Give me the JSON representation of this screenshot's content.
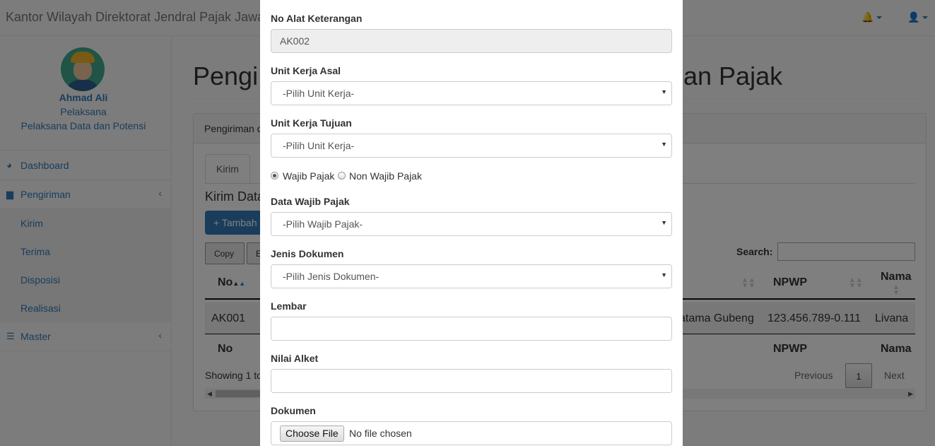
{
  "navbar": {
    "brand": "Kantor Wilayah Direktorat Jendral Pajak Jawa",
    "bell_icon": "bell-icon",
    "user_icon": "user-icon"
  },
  "sidebar": {
    "profile": {
      "name": "Ahmad Ali",
      "role": "Pelaksana",
      "unit": "Pelaksana Data dan Potensi"
    },
    "items": [
      {
        "label": "Dashboard",
        "icon": "dashboard-icon"
      },
      {
        "label": "Pengiriman",
        "icon": "bar-chart-icon",
        "arrow": "‹"
      },
      {
        "label": "Master",
        "icon": "list-icon",
        "arrow": "‹"
      }
    ],
    "submenu": [
      "Kirim",
      "Terima",
      "Disposisi",
      "Realisasi"
    ]
  },
  "page": {
    "title_left": "Pengi",
    "title_right": "an Pajak",
    "panel_heading": "Pengiriman d",
    "tab_label": "Kirim",
    "section_title": "Kirim Data",
    "add_button": "+ Tambah",
    "copy_button": "Copy",
    "second_button": "E",
    "search_label": "Search:",
    "table": {
      "headers": {
        "no": "No",
        "npwp": "NPWP",
        "nama": "Nama"
      },
      "row": {
        "no": "AK001",
        "unit": "atama Gubeng",
        "npwp": "123.456.789-0.111",
        "nama": "Livana"
      },
      "footer": {
        "no": "No",
        "npwp": "NPWP",
        "nama": "Nama"
      }
    },
    "showing": "Showing 1 to",
    "pagination": {
      "previous": "Previous",
      "current": "1",
      "next": "Next"
    }
  },
  "modal": {
    "no_alat_label": "No Alat Keterangan",
    "no_alat_value": "AK002",
    "unit_asal_label": "Unit Kerja Asal",
    "unit_asal_value": "-Pilih Unit Kerja-",
    "unit_tujuan_label": "Unit Kerja Tujuan",
    "unit_tujuan_value": "-Pilih Unit Kerja-",
    "radio_wajib": "Wajib Pajak",
    "radio_non_wajib": "Non Wajib Pajak",
    "data_wp_label": "Data Wajib Pajak",
    "data_wp_value": "-Pilih Wajib Pajak-",
    "jenis_dok_label": "Jenis Dokumen",
    "jenis_dok_value": "-Pilih Jenis Dokumen-",
    "lembar_label": "Lembar",
    "lembar_value": "",
    "nilai_label": "Nilai Alket",
    "nilai_value": "",
    "dokumen_label": "Dokumen",
    "file_button": "Choose File",
    "file_status": "No file chosen"
  }
}
